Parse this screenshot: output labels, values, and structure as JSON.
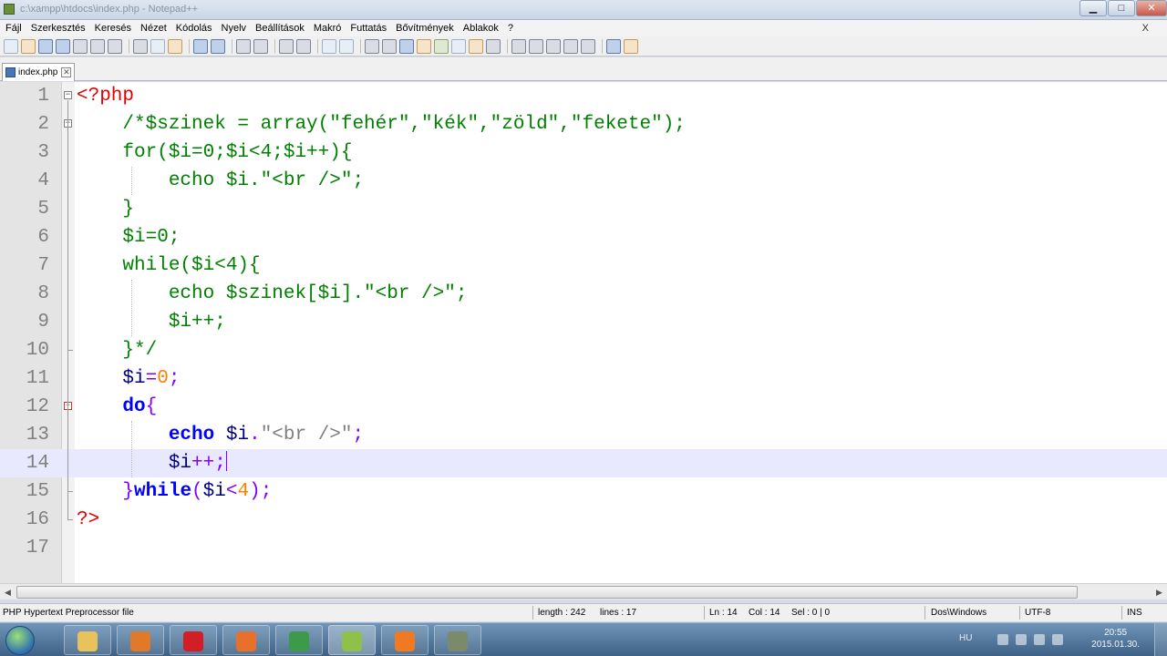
{
  "window": {
    "title": "c:\\xampp\\htdocs\\index.php - Notepad++",
    "buttons": {
      "minimize": "▁",
      "maximize": "□",
      "close": "✕"
    }
  },
  "menu": {
    "items": [
      "Fájl",
      "Szerkesztés",
      "Keresés",
      "Nézet",
      "Kódolás",
      "Nyelv",
      "Beállítások",
      "Makró",
      "Futtatás",
      "Bővítmények",
      "Ablakok",
      "?"
    ],
    "close_doc": "X"
  },
  "toolbar": {
    "icons": [
      "new-file-icon",
      "open-file-icon",
      "save-icon",
      "save-all-icon",
      "close-icon",
      "close-all-icon",
      "print-icon",
      "cut-icon",
      "copy-icon",
      "paste-icon",
      "undo-icon",
      "redo-icon",
      "find-icon",
      "replace-icon",
      "zoom-in-icon",
      "zoom-out-icon",
      "sync-v-icon",
      "sync-h-icon",
      "word-wrap-icon",
      "show-all-chars-icon",
      "indent-guide-icon",
      "user-lang-icon",
      "doc-map-icon",
      "function-list-icon",
      "folder-workspace-icon",
      "monitor-icon",
      "record-macro-icon",
      "stop-record-icon",
      "play-macro-icon",
      "play-multiple-icon",
      "save-macro-icon",
      "spell-check-icon",
      "ftp-icon"
    ]
  },
  "tabs": [
    {
      "label": "index.php",
      "close": "✕"
    }
  ],
  "editor": {
    "current_line": 14,
    "line_numbers": [
      "1",
      "2",
      "3",
      "4",
      "5",
      "6",
      "7",
      "8",
      "9",
      "10",
      "11",
      "12",
      "13",
      "14",
      "15",
      "16",
      "17"
    ],
    "lines": [
      [
        {
          "t": "<?php",
          "c": "php"
        }
      ],
      [
        {
          "t": "    /*$szinek = array(\"fehér\",\"kék\",\"zöld\",\"fekete\");",
          "c": "comment"
        }
      ],
      [
        {
          "t": "    for($i=0;$i<4;$i++){",
          "c": "comment"
        }
      ],
      [
        {
          "t": "        echo $i.\"<br />\";",
          "c": "comment"
        }
      ],
      [
        {
          "t": "    }",
          "c": "comment"
        }
      ],
      [
        {
          "t": "    $i=0;",
          "c": "comment"
        }
      ],
      [
        {
          "t": "    while($i<4){",
          "c": "comment"
        }
      ],
      [
        {
          "t": "        echo $szinek[$i].\"<br />\";",
          "c": "comment"
        }
      ],
      [
        {
          "t": "        $i++;",
          "c": "comment"
        }
      ],
      [
        {
          "t": "    }*/",
          "c": "comment"
        }
      ],
      [
        {
          "t": "    ",
          "c": "plain"
        },
        {
          "t": "$i",
          "c": "var"
        },
        {
          "t": "=",
          "c": "op"
        },
        {
          "t": "0",
          "c": "num"
        },
        {
          "t": ";",
          "c": "op"
        }
      ],
      [
        {
          "t": "    ",
          "c": "plain"
        },
        {
          "t": "do",
          "c": "kw"
        },
        {
          "t": "{",
          "c": "op"
        }
      ],
      [
        {
          "t": "        ",
          "c": "plain"
        },
        {
          "t": "echo",
          "c": "kw"
        },
        {
          "t": " ",
          "c": "plain"
        },
        {
          "t": "$i",
          "c": "var"
        },
        {
          "t": ".",
          "c": "op"
        },
        {
          "t": "\"<br />\"",
          "c": "str"
        },
        {
          "t": ";",
          "c": "op"
        }
      ],
      [
        {
          "t": "        ",
          "c": "plain"
        },
        {
          "t": "$i",
          "c": "var"
        },
        {
          "t": "++;",
          "c": "op"
        }
      ],
      [
        {
          "t": "    ",
          "c": "plain"
        },
        {
          "t": "}",
          "c": "op"
        },
        {
          "t": "while",
          "c": "kw"
        },
        {
          "t": "(",
          "c": "op"
        },
        {
          "t": "$i",
          "c": "var"
        },
        {
          "t": "<",
          "c": "op"
        },
        {
          "t": "4",
          "c": "num"
        },
        {
          "t": ");",
          "c": "op"
        }
      ],
      [
        {
          "t": "?>",
          "c": "php"
        }
      ],
      [
        {
          "t": "",
          "c": "plain"
        }
      ]
    ]
  },
  "statusbar": {
    "file_type": "PHP Hypertext Preprocessor file",
    "length": "length : 242",
    "lines": "lines : 17",
    "ln": "Ln : 14",
    "col": "Col : 14",
    "sel": "Sel : 0 | 0",
    "eol": "Dos\\Windows",
    "encoding": "UTF-8",
    "mode": "INS"
  },
  "taskbar": {
    "apps": [
      {
        "name": "explorer-icon",
        "color": "#e8c25a"
      },
      {
        "name": "media-player-icon",
        "color": "#e07a2a"
      },
      {
        "name": "opera-icon",
        "color": "#d21f26"
      },
      {
        "name": "firefox-icon",
        "color": "#e8702a"
      },
      {
        "name": "chrome-icon",
        "color": "#3c9a4a"
      },
      {
        "name": "notepadpp-icon",
        "color": "#8fc04a"
      },
      {
        "name": "xampp-icon",
        "color": "#f07a22"
      },
      {
        "name": "tools-icon",
        "color": "#7a8a6a"
      }
    ],
    "active_app": 5,
    "lang": "HU",
    "clock_time": "20:55",
    "clock_date": "2015.01.30."
  }
}
